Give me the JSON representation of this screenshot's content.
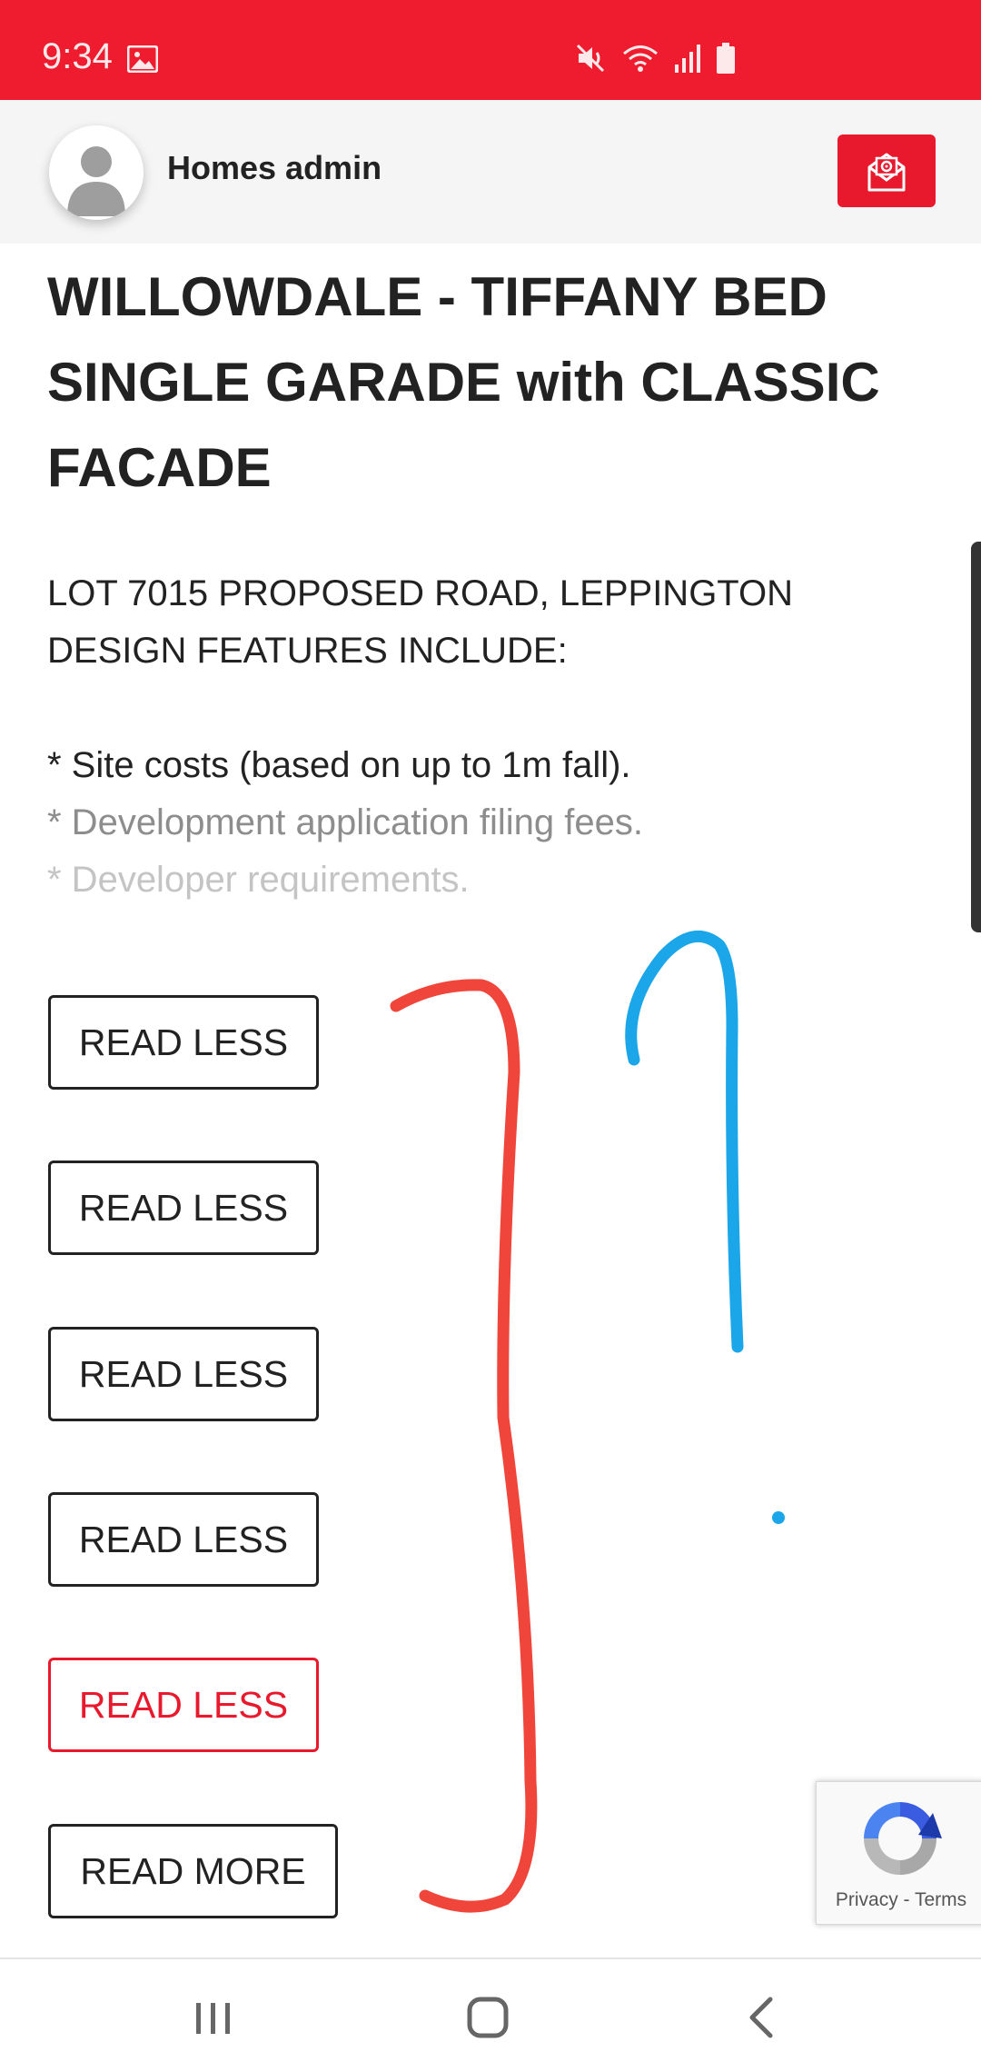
{
  "status_bar": {
    "time": "9:34",
    "left_icons": [
      "image-icon"
    ],
    "right_icons": [
      "mute-icon",
      "wifi-icon",
      "signal-icon",
      "battery-icon"
    ],
    "background_color": "#ee1c2e"
  },
  "header": {
    "user_name": "Homes admin",
    "avatar_icon": "person-icon",
    "mail_button_icon": "mail-icon"
  },
  "listing": {
    "title": "WILLOWDALE - TIFFANY BED SINGLE GARADE with CLASSIC FACADE",
    "address": "LOT 7015 PROPOSED ROAD, LEPPINGTON",
    "features_heading": "DESIGN FEATURES INCLUDE:",
    "features": [
      "* Site costs (based on up to 1m fall).",
      "* Development application filing fees.",
      "* Developer requirements."
    ]
  },
  "buttons": [
    {
      "label": "READ LESS"
    },
    {
      "label": "READ LESS"
    },
    {
      "label": "READ LESS"
    },
    {
      "label": "READ LESS"
    },
    {
      "label": "READ LESS",
      "state": "active"
    },
    {
      "label": "READ MORE"
    }
  ],
  "recaptcha": {
    "label": "Privacy - Terms"
  },
  "nav_bar": {
    "items": [
      "recent-apps-icon",
      "home-icon",
      "back-icon"
    ]
  },
  "colors": {
    "accent": "#e8192c",
    "red_annotation": "#f0453a",
    "blue_annotation": "#1aa6e8"
  }
}
